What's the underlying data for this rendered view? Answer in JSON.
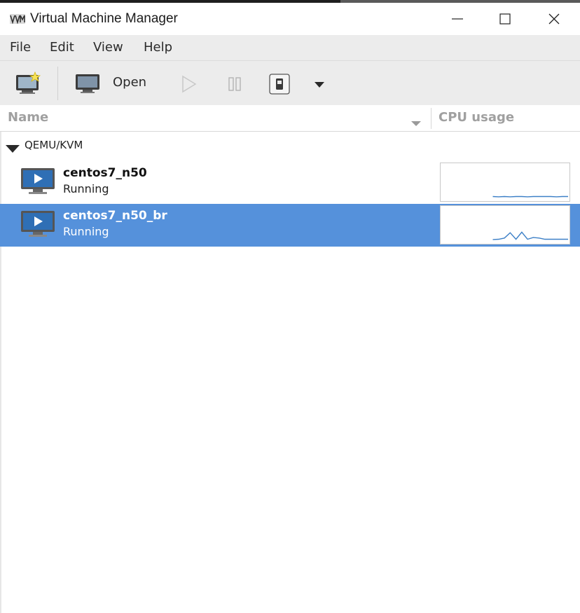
{
  "window": {
    "title": "Virtual Machine Manager",
    "icons": {
      "app": "vmm-app-icon",
      "minimize": "minimize-icon",
      "maximize": "maximize-icon",
      "close": "close-icon"
    }
  },
  "menubar": {
    "items": [
      "File",
      "Edit",
      "View",
      "Help"
    ]
  },
  "toolbar": {
    "new_vm": {
      "icon": "new-vm-icon"
    },
    "open": {
      "label": "Open",
      "icon": "monitor-icon"
    },
    "run": {
      "icon": "play-icon",
      "enabled": false
    },
    "pause": {
      "icon": "pause-icon",
      "enabled": false
    },
    "shutdown": {
      "icon": "shutdown-icon",
      "enabled": true
    },
    "more": {
      "icon": "dropdown-arrow-icon"
    }
  },
  "columns": {
    "name": "Name",
    "cpu": "CPU usage"
  },
  "group": {
    "label": "QEMU/KVM",
    "expanded": true
  },
  "vms": [
    {
      "name": "centos7_n50",
      "status": "Running",
      "selected": false,
      "cpu_history": [
        0,
        0,
        0.06,
        0.05,
        0.06,
        0.05,
        0.06,
        0.06,
        0.05,
        0.06,
        0.06,
        0.06,
        0.06,
        0.05,
        0.06,
        0.06
      ]
    },
    {
      "name": "centos7_n50_br",
      "status": "Running",
      "selected": true,
      "cpu_history": [
        0,
        0,
        0.05,
        0.06,
        0.1,
        0.28,
        0.06,
        0.3,
        0.06,
        0.12,
        0.1,
        0.06,
        0.06,
        0.06,
        0.06,
        0.06
      ]
    }
  ],
  "colors": {
    "selection": "#5591db",
    "sparkline": "#3d80c7",
    "menubar_bg": "#ececec"
  }
}
